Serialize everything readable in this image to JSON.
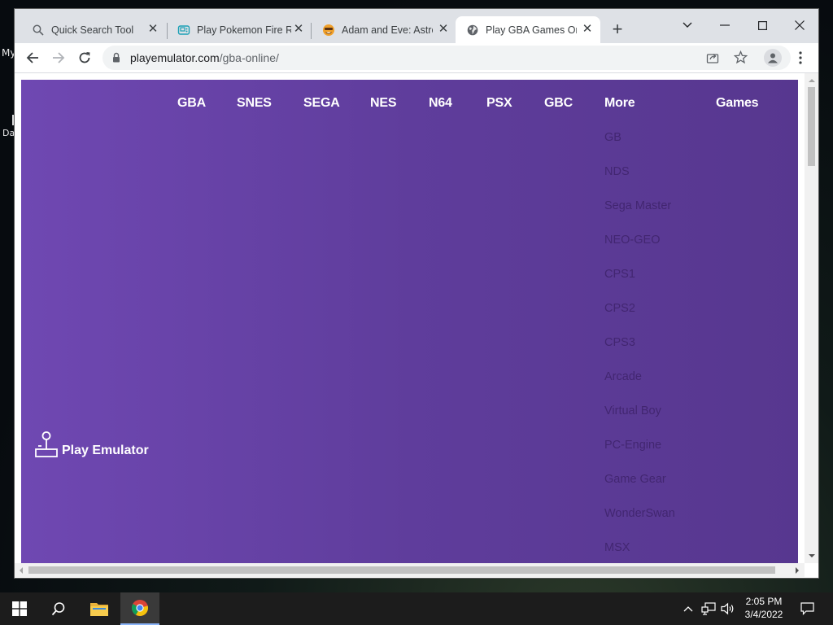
{
  "desktop": {
    "label_top": "My",
    "label_bottom": "Da"
  },
  "browser": {
    "tabs": [
      {
        "title": "Quick Search Tool",
        "icon": "search-icon"
      },
      {
        "title": "Play Pokemon Fire Re",
        "icon": "gameboy-icon"
      },
      {
        "title": "Adam and Eve: Astron",
        "icon": "smiley-icon"
      },
      {
        "title": "Play GBA Games Onli",
        "icon": "globe-icon",
        "active": true
      }
    ],
    "url_host": "playemulator.com",
    "url_path": "/gba-online/"
  },
  "site": {
    "logo_text": "Play Emulator",
    "nav": [
      "GBA",
      "SNES",
      "SEGA",
      "NES",
      "N64",
      "PSX",
      "GBC",
      "More",
      "Games"
    ],
    "more_menu": [
      "GB",
      "NDS",
      "Sega Master",
      "NEO-GEO",
      "CPS1",
      "CPS2",
      "CPS3",
      "Arcade",
      "Virtual Boy",
      "PC-Engine",
      "Game Gear",
      "WonderSwan",
      "MSX"
    ],
    "colors": {
      "background": "#6a45aa",
      "nav_text": "#ffffff",
      "submenu_text": "#3a2065"
    }
  },
  "taskbar": {
    "time": "2:05 PM",
    "date": "3/4/2022"
  }
}
